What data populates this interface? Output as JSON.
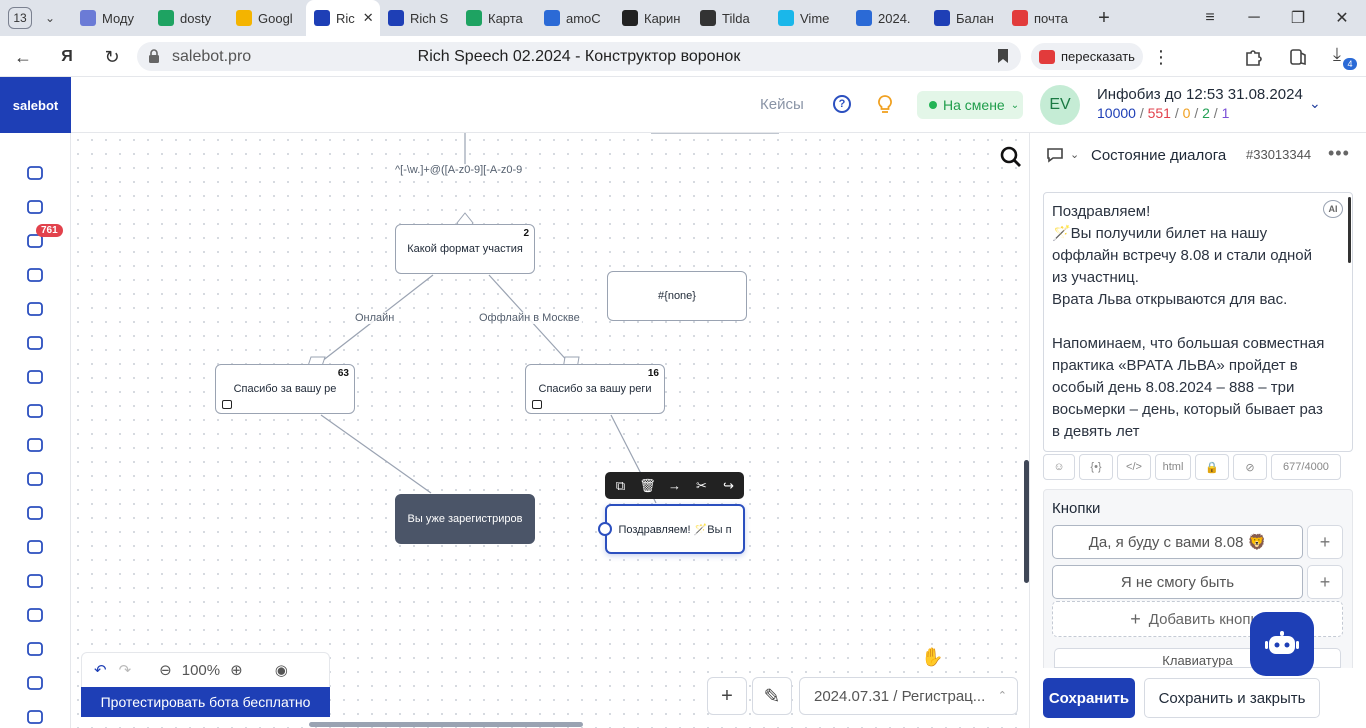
{
  "browser": {
    "tab_count": "13",
    "tabs": [
      {
        "label": "Моду",
        "fav_color": "#6b7bd6"
      },
      {
        "label": "dosty",
        "fav_color": "#1ea362"
      },
      {
        "label": "Googl",
        "fav_color": "#f4b400"
      },
      {
        "label": "Ric",
        "fav_color": "#1e3fb6"
      },
      {
        "label": "Rich S",
        "fav_color": "#1e3fb6"
      },
      {
        "label": "Карта",
        "fav_color": "#1ea362"
      },
      {
        "label": "amoC",
        "fav_color": "#2b6ad6"
      },
      {
        "label": "Карин",
        "fav_color": "#222222"
      },
      {
        "label": "Tilda",
        "fav_color": "#333333"
      },
      {
        "label": "Vime",
        "fav_color": "#1ab7ea"
      },
      {
        "label": "2024.",
        "fav_color": "#2b6ad6"
      },
      {
        "label": "Балан",
        "fav_color": "#1e3fb6"
      },
      {
        "label": "почта",
        "fav_color": "#e23b3b"
      }
    ],
    "url_host": "salebot.pro",
    "page_title": "Rich Speech 02.2024 - Конструктор воронок",
    "retell_label": "пересказать",
    "downloads_badge": "4"
  },
  "app": {
    "logo": "salebot",
    "sidebar_badge": "761",
    "header": {
      "cases": "Кейсы",
      "shift": "На смене",
      "avatar_initials": "EV",
      "account_name": "Инфобиз до 12:53 31.08.2024",
      "stats": [
        {
          "value": "10000",
          "color": "#1e3fb6"
        },
        {
          "value": "551",
          "color": "#e2424c"
        },
        {
          "value": "0",
          "color": "#f0a020"
        },
        {
          "value": "2",
          "color": "#22a055"
        },
        {
          "value": "1",
          "color": "#7a4fd6"
        }
      ]
    }
  },
  "canvas": {
    "regex_label": "^[-\\w.]+@([A-z0-9][-A-z0-9",
    "nodes": {
      "format": {
        "label": "Какой формат участия",
        "count": "2"
      },
      "none": {
        "label": "#{none}"
      },
      "thanks1": {
        "label": "Спасибо за вашу ре",
        "count": "63"
      },
      "thanks2": {
        "label": "Спасибо за вашу реги",
        "count": "16"
      },
      "registered": {
        "label": "Вы уже зарегистриров"
      },
      "congrats": {
        "label": "Поздравляем! 🪄Вы п"
      }
    },
    "edge_labels": {
      "online": "Онлайн",
      "offline": "Оффлайн в Москве"
    },
    "zoom": "100%",
    "test_bot": "Протестировать бота бесплатно",
    "funnel_select": "2024.07.31 / Регистрац..."
  },
  "panel": {
    "title": "Состояние диалога",
    "id": "#33013344",
    "message_lines": [
      "Поздравляем!",
      "🪄Вы получили билет на нашу оффлайн встречу 8.08 и стали одной из участниц.",
      "Врата Льва открываются для вас.",
      "",
      "Напоминаем, что большая совместная практика «ВРАТА ЛЬВА» пройдет в особый день 8.08.2024 – 888 – три восьмерки – день, который бывает раз в девять лет"
    ],
    "ai_label": "AI",
    "html_label": "html",
    "char_count": "677/4000",
    "buttons_title": "Кнопки",
    "buttons": [
      "Да, я буду с вами 8.08 🦁",
      "Я не смогу быть"
    ],
    "add_button": "Добавить кнопку",
    "keyboard": "Клавиатура",
    "save": "Сохранить",
    "save_close": "Сохранить и закрыть"
  }
}
